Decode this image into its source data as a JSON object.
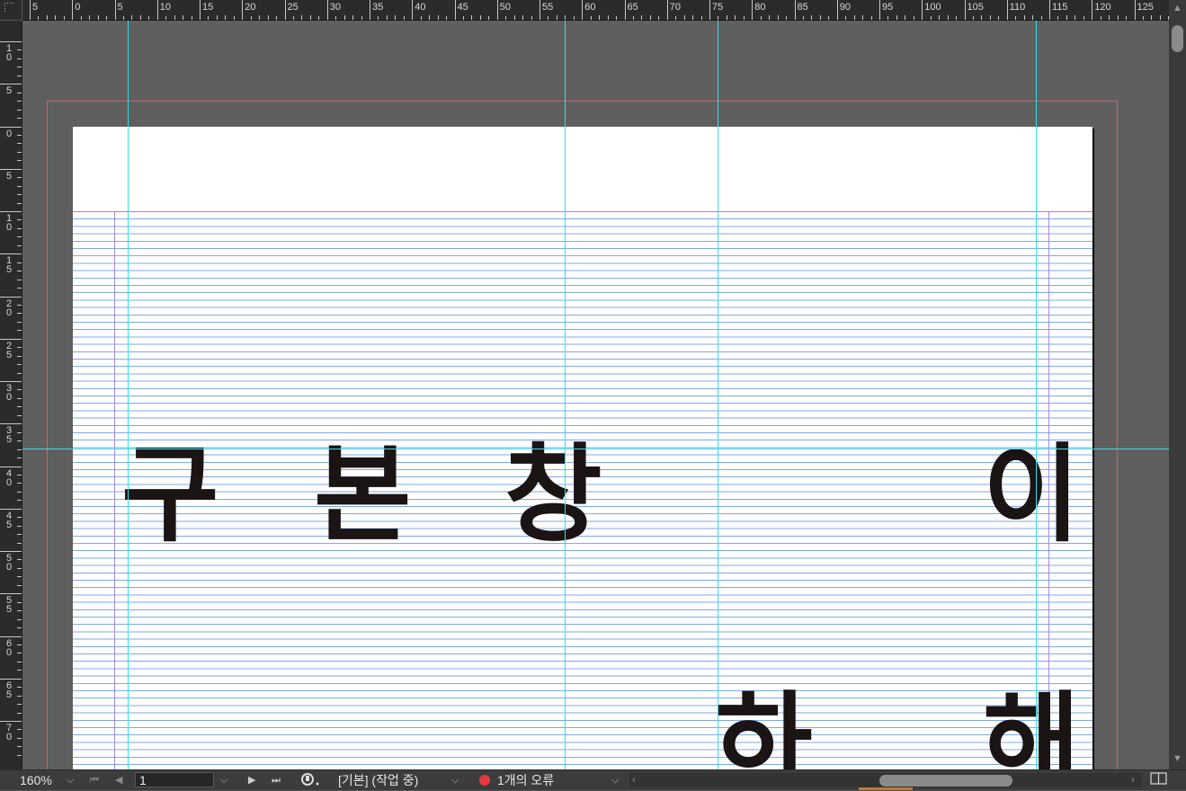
{
  "ruler": {
    "top_labels": [
      "5",
      "0",
      "5",
      "10",
      "15",
      "20",
      "25",
      "30",
      "35",
      "40",
      "45",
      "50",
      "55",
      "60",
      "65",
      "70",
      "75",
      "80",
      "85",
      "90",
      "95",
      "100",
      "105",
      "110",
      "115",
      "120",
      "125"
    ],
    "left_labels": [
      "1\n0",
      "5",
      "0",
      "5",
      "1\n0",
      "1\n5",
      "2\n0",
      "2\n5",
      "3\n0",
      "3\n5",
      "4\n0",
      "4\n5",
      "5\n0",
      "5\n5",
      "6\n0",
      "6\n5",
      "7\n0"
    ]
  },
  "document": {
    "glyphs": [
      "구",
      "본",
      "창",
      "이",
      "하",
      "해"
    ]
  },
  "status_bar": {
    "zoom": "160%",
    "page_number": "1",
    "style_status": "[기본] (작업 중)",
    "error_text": "1개의 오류"
  },
  "colors": {
    "guide": "#33e0f0",
    "bleed": "#e05a5a",
    "baseline_grid": "#7fa8e6",
    "error": "#e8373d"
  },
  "icons": [
    "first-page-icon",
    "prev-page-icon",
    "next-page-icon",
    "last-page-icon",
    "preflight-icon",
    "chevron-down-icon",
    "split-view-icon"
  ]
}
